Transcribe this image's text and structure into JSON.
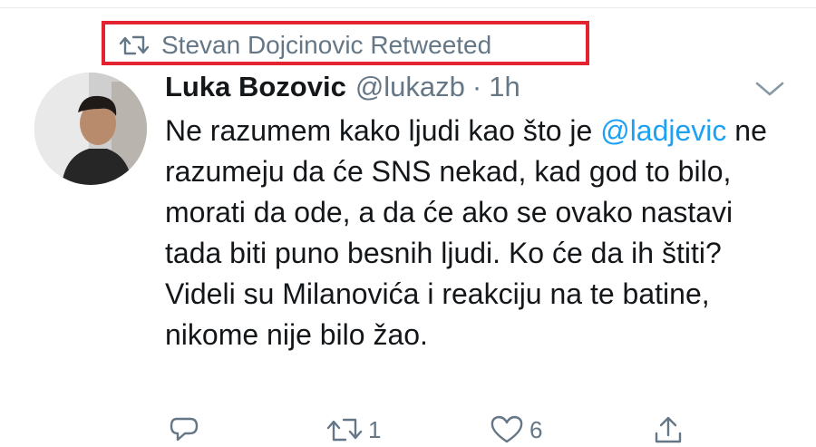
{
  "retweet": {
    "label": "Stevan Dojcinovic Retweeted",
    "icon": "retweet-icon",
    "highlight_color": "#e3232f"
  },
  "tweet": {
    "author_name": "Luka Bozovic",
    "handle": "@lukazb",
    "separator": "·",
    "time": "1h",
    "text_parts": [
      "Ne razumem kako ljudi kao što je ",
      "@ladjevic",
      " ne razumeju da će SNS nekad, kad god to bilo, morati da ode, a da će ako se ovako nastavi tada biti puno besnih ljudi. Ko će da ih štiti? Videli su Milanovića i reakciju na te batine, nikome nije bilo žao."
    ],
    "mention_color": "#1da1f2"
  },
  "actions": {
    "reply_count": "",
    "retweet_count": "1",
    "like_count": "6"
  },
  "colors": {
    "secondary_text": "#657786",
    "primary_text": "#14171a"
  }
}
